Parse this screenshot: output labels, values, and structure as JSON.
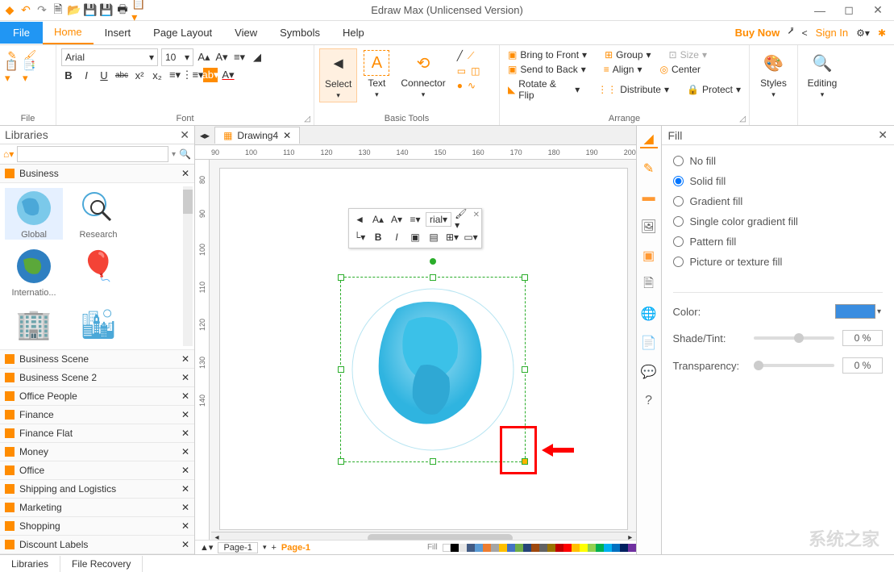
{
  "app": {
    "title": "Edraw Max (Unlicensed Version)"
  },
  "qat": {
    "undo": "↶",
    "redo": "↷"
  },
  "menu": {
    "file": "File",
    "items": [
      "Home",
      "Insert",
      "Page Layout",
      "View",
      "Symbols",
      "Help"
    ],
    "active": 0,
    "buy_now": "Buy Now",
    "sign_in": "Sign In"
  },
  "ribbon": {
    "file_group": "File",
    "font_group": "Font",
    "font_name": "Arial",
    "font_size": "10",
    "bold": "B",
    "italic": "I",
    "underline": "U",
    "strike": "abc",
    "tools_group": "Basic Tools",
    "select": "Select",
    "text": "Text",
    "connector": "Connector",
    "arrange_group": "Arrange",
    "bring_front": "Bring to Front",
    "send_back": "Send to Back",
    "rotate_flip": "Rotate & Flip",
    "group": "Group",
    "align": "Align",
    "distribute": "Distribute",
    "size": "Size",
    "center": "Center",
    "protect": "Protect",
    "styles": "Styles",
    "editing": "Editing"
  },
  "libraries": {
    "title": "Libraries",
    "top_category": "Business",
    "shapes": [
      "Global",
      "Research",
      "Internatio..."
    ],
    "categories": [
      "Business Scene",
      "Business Scene 2",
      "Office People",
      "Finance",
      "Finance Flat",
      "Money",
      "Office",
      "Shipping and Logistics",
      "Marketing",
      "Shopping",
      "Discount Labels"
    ]
  },
  "doc": {
    "tab": "Drawing4",
    "ruler_h": [
      "90",
      "100",
      "110",
      "120",
      "130",
      "140",
      "150",
      "160",
      "170",
      "180",
      "190",
      "200"
    ],
    "ruler_v": [
      "80",
      "90",
      "100",
      "110",
      "120",
      "130",
      "140"
    ]
  },
  "float": {
    "font": "rial"
  },
  "fill_panel": {
    "title": "Fill",
    "options": [
      "No fill",
      "Solid fill",
      "Gradient fill",
      "Single color gradient fill",
      "Pattern fill",
      "Picture or texture fill"
    ],
    "selected": 1,
    "color_label": "Color:",
    "shade_label": "Shade/Tint:",
    "shade_value": "0 %",
    "transparency_label": "Transparency:",
    "transparency_value": "0 %"
  },
  "pages": {
    "p1": "Page-1",
    "fill_label": "Fill"
  },
  "bottom": {
    "tabs": [
      "Libraries",
      "File Recovery"
    ]
  },
  "watermark": "系统之家"
}
